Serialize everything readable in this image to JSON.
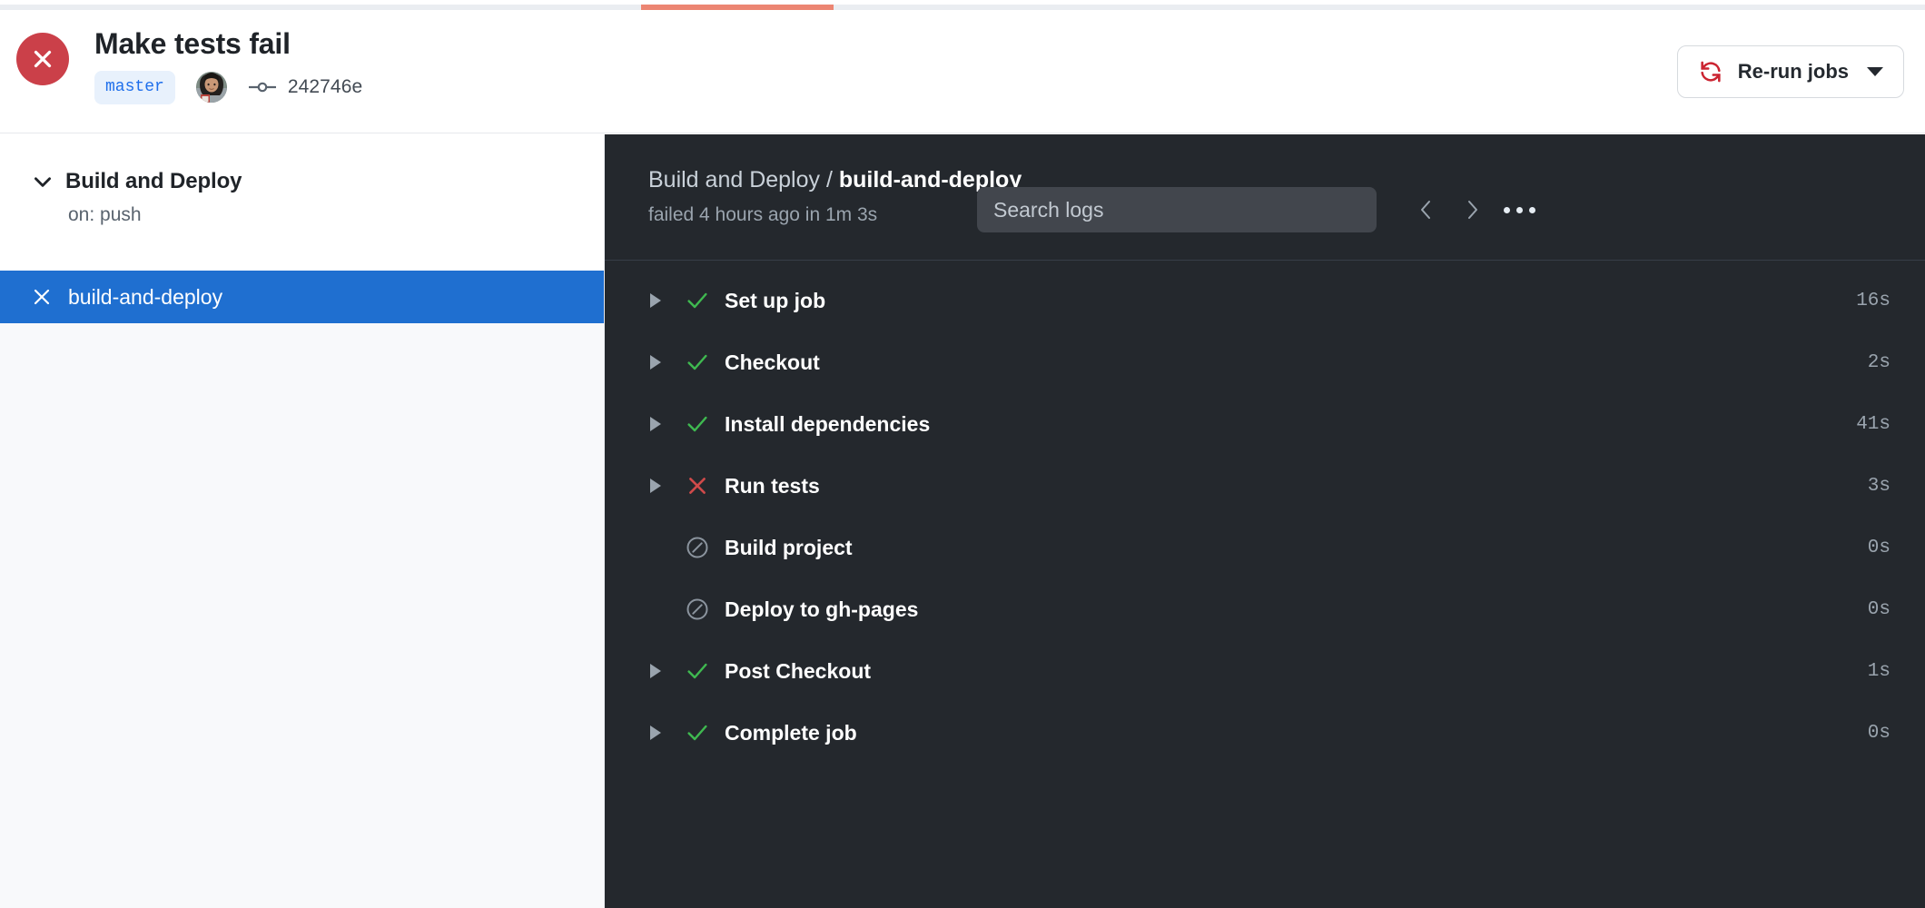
{
  "colors": {
    "failure_red": "#cb4049",
    "accent_blue": "#1f6fd0",
    "branch_blue": "#1f6feb",
    "progress_salmon": "#ec8572",
    "log_bg": "#24282d",
    "success_green": "#3fb950",
    "error_red": "#cf4a4a",
    "skipped_gray": "#8b949e"
  },
  "top_indicator": {
    "name": "run-progress-indicator",
    "fill_percent": 10
  },
  "header": {
    "status_icon": "x-circle-icon",
    "status": "failure",
    "title": "Make tests fail",
    "branch": "master",
    "avatar_alt": "author-avatar",
    "commit_icon": "git-commit-icon",
    "commit_sha": "242746e",
    "rerun": {
      "icon": "sync-refresh-icon",
      "label": "Re-run jobs",
      "caret_icon": "triangle-down-icon"
    }
  },
  "sidebar": {
    "workflow": {
      "chevron_icon": "chevron-down-icon",
      "name": "Build and Deploy",
      "trigger": "on: push"
    },
    "jobs": [
      {
        "icon": "x-icon",
        "name": "build-and-deploy",
        "status": "failure",
        "selected": true
      }
    ]
  },
  "logs": {
    "breadcrumb_prefix": "Build and Deploy / ",
    "breadcrumb_job": "build-and-deploy",
    "subtitle": "failed 4 hours ago in 1m 3s",
    "search_placeholder": "Search logs",
    "search_value": "",
    "prev_icon": "chevron-left-icon",
    "next_icon": "chevron-right-icon",
    "menu_icon": "kebab-horizontal-icon",
    "steps": [
      {
        "name": "Set up job",
        "status": "success",
        "duration": "16s",
        "expandable": true
      },
      {
        "name": "Checkout",
        "status": "success",
        "duration": "2s",
        "expandable": true
      },
      {
        "name": "Install dependencies",
        "status": "success",
        "duration": "41s",
        "expandable": true
      },
      {
        "name": "Run tests",
        "status": "failure",
        "duration": "3s",
        "expandable": true
      },
      {
        "name": "Build project",
        "status": "skipped",
        "duration": "0s",
        "expandable": false
      },
      {
        "name": "Deploy to gh-pages",
        "status": "skipped",
        "duration": "0s",
        "expandable": false
      },
      {
        "name": "Post Checkout",
        "status": "success",
        "duration": "1s",
        "expandable": true
      },
      {
        "name": "Complete job",
        "status": "success",
        "duration": "0s",
        "expandable": true
      }
    ]
  }
}
